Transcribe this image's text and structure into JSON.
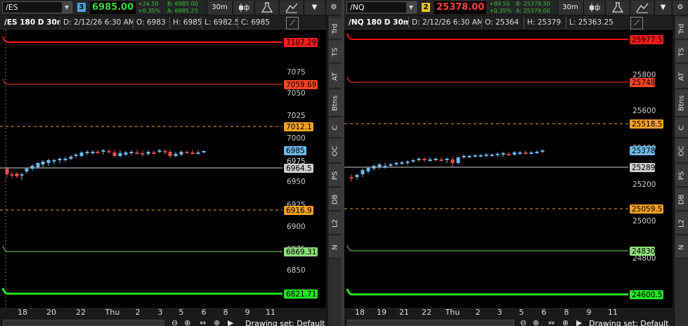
{
  "colors": {
    "up": "#6fb8ea",
    "down": "#e74a4a",
    "red_line": "#ff1010",
    "orange_line": "#ff3b1a",
    "dash_line": "#f4a020",
    "white_line": "#cccccc",
    "light_green_line": "#7ed86a",
    "green_line": "#22e522"
  },
  "left": {
    "symbol": "/ES",
    "link_number": "3",
    "link_color": "#4aa3df",
    "last_price": "6985.00",
    "last_price_color": "#3bd83b",
    "change": "+24.50",
    "change_pct": "+0.35%",
    "bid": "B: 6985.00",
    "ask": "A: 6985.25",
    "timeframe": "30m",
    "header": {
      "title": "/ES 180 D 30m",
      "date": "D: 2/12/26 6:30 AM",
      "open": "O: 6983",
      "high": "H: 6985",
      "low": "L: 6982.5",
      "close": "C: 6985"
    },
    "y_ticks": [
      "7075",
      "7050",
      "7025",
      "7000",
      "6975",
      "6950",
      "6925",
      "6900",
      "6875",
      "6850"
    ],
    "price_labels": [
      {
        "text": "7107.29",
        "bg": "#ff1a1a",
        "fg": "#000"
      },
      {
        "text": "7059.69",
        "bg": "#ff4422",
        "fg": "#000"
      },
      {
        "text": "7012.1",
        "bg": "#f4a020",
        "fg": "#000"
      },
      {
        "text": "6985",
        "bg": "#6fb8ea",
        "fg": "#000"
      },
      {
        "text": "6964.5",
        "bg": "#cccccc",
        "fg": "#000"
      },
      {
        "text": "6916.9",
        "bg": "#f4a020",
        "fg": "#000"
      },
      {
        "text": "6869.31",
        "bg": "#8ee07a",
        "fg": "#000"
      },
      {
        "text": "6821.71",
        "bg": "#22e522",
        "fg": "#000"
      }
    ],
    "x_ticks": [
      "18",
      "20",
      "22",
      "Thu",
      "2",
      "3",
      "5",
      "6",
      "8",
      "9",
      "11"
    ],
    "drawing_set": "Drawing set: Default"
  },
  "right": {
    "symbol": "/NQ",
    "link_number": "2",
    "link_color": "#e8c020",
    "last_price": "25378.00",
    "last_price_color": "#ff4040",
    "change": "+89.50",
    "change_pct": "+0.35%",
    "bid": "B: 25378.50",
    "ask": "A: 25379.00",
    "timeframe": "30m",
    "header": {
      "title": "/NQ 180 D 30m",
      "date": "D: 2/12/26 6:30 AM",
      "open": "O: 25364",
      "high": "H: 25379",
      "low": "L: 25363.25",
      "close": ""
    },
    "y_ticks": [
      "25800",
      "25600",
      "25400",
      "25200",
      "25000",
      "24800"
    ],
    "price_labels": [
      {
        "text": "25977.5",
        "bg": "#ff1a1a",
        "fg": "#000"
      },
      {
        "text": "25748",
        "bg": "#ff4422",
        "fg": "#000"
      },
      {
        "text": "25518.5",
        "bg": "#f4a020",
        "fg": "#000"
      },
      {
        "text": "25378",
        "bg": "#6fb8ea",
        "fg": "#000"
      },
      {
        "text": "25289",
        "bg": "#cccccc",
        "fg": "#000"
      },
      {
        "text": "25059.5",
        "bg": "#f4a020",
        "fg": "#000"
      },
      {
        "text": "24830",
        "bg": "#8ee07a",
        "fg": "#000"
      },
      {
        "text": "24600.5",
        "bg": "#22e522",
        "fg": "#000"
      }
    ],
    "x_ticks": [
      "18",
      "19",
      "21",
      "22",
      "Thu",
      "2",
      "3",
      "5",
      "6",
      "8",
      "9",
      "11"
    ],
    "drawing_set": "Drawing set: Default"
  },
  "sidebar_tabs": [
    "Trd",
    "TS",
    "AT",
    "Btns",
    "C",
    "OC",
    "PS",
    "DB",
    "L2",
    "N"
  ],
  "icons": {
    "dropdown": "chevron-down-icon",
    "style": "candle-style-icon",
    "studies": "flask-icon",
    "drawings": "drawing-tools-icon",
    "settings": "gear-icon",
    "draw_toggle": "pencil-line-icon"
  }
}
